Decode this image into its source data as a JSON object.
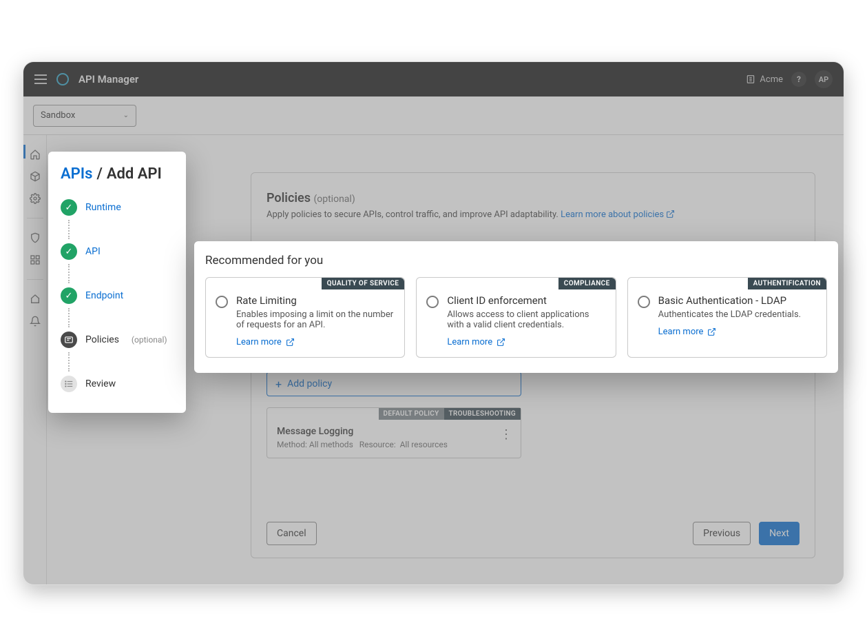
{
  "header": {
    "app_title": "API Manager",
    "org": "Acme",
    "help": "?",
    "avatar": "AP"
  },
  "env_select": "Sandbox",
  "breadcrumb": {
    "root": "APIs",
    "current": "Add API"
  },
  "steps": {
    "runtime": "Runtime",
    "api": "API",
    "endpoint": "Endpoint",
    "policies": "Policies",
    "policies_suffix": "(optional)",
    "review": "Review"
  },
  "panel": {
    "title": "Policies",
    "title_suffix": "(optional)",
    "desc": "Apply policies to secure APIs, control traffic, and improve API adaptability.",
    "learn_link": "Learn more about policies",
    "add_policy": "Add policy"
  },
  "applied": {
    "tag1": "DEFAULT POLICY",
    "tag2": "TROUBLESHOOTING",
    "title": "Message Logging",
    "method_label": "Method:",
    "method_value": "All methods",
    "resource_label": "Resource:",
    "resource_value": "All resources"
  },
  "footer": {
    "cancel": "Cancel",
    "previous": "Previous",
    "next": "Next"
  },
  "reco": {
    "heading": "Recommended for you",
    "learn": "Learn more",
    "cards": [
      {
        "tag": "QUALITY OF SERVICE",
        "name": "Rate Limiting",
        "desc": "Enables imposing a limit on the number of requests for an API."
      },
      {
        "tag": "COMPLIANCE",
        "name": "Client ID enforcement",
        "desc": " Allows access to client applications with a valid client credentials."
      },
      {
        "tag": "AUTHENTIFICATION",
        "name": "Basic Authentication - LDAP",
        "desc": "Authenticates the LDAP credentials."
      }
    ]
  }
}
